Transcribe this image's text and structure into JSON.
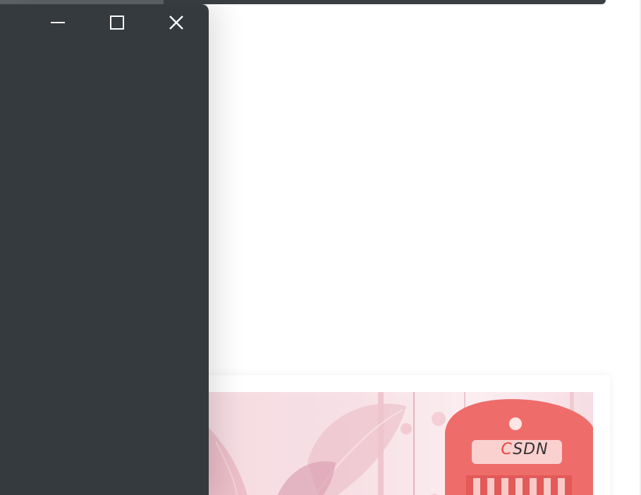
{
  "window": {
    "controls": [
      {
        "id": "minimize",
        "icon": "minimize-icon"
      },
      {
        "id": "maximize",
        "icon": "maximize-icon"
      },
      {
        "id": "close",
        "icon": "close-icon"
      }
    ],
    "background_color": "#353a3e"
  },
  "banner": {
    "logo_first_letter": "C",
    "logo_rest": "SDN",
    "accent_color": "#ee6d6b"
  }
}
